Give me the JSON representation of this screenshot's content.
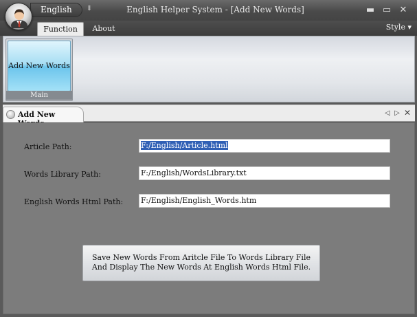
{
  "window": {
    "title": "English Helper System - [Add New Words]",
    "quick_access_label": "English",
    "controls": {
      "minimize": "▬",
      "maximize": "▭",
      "close": "✕"
    }
  },
  "ribbon": {
    "tabs": [
      {
        "label": "Function",
        "selected": true
      },
      {
        "label": "About",
        "selected": false
      }
    ],
    "style_menu": "Style",
    "groups": [
      {
        "label": "Main",
        "buttons": [
          {
            "label": "Add New Words"
          }
        ]
      }
    ]
  },
  "document": {
    "tab_label": "Add New Words",
    "fields": [
      {
        "label": "Article Path:",
        "value": "F:/English/Article.html",
        "selected": true
      },
      {
        "label": "Words Library Path:",
        "value": "F:/English/WordsLibrary.txt"
      },
      {
        "label": "English Words Html Path:",
        "value": "F:/English/English_Words.htm"
      }
    ],
    "action_button": {
      "line1": "Save New Words From Aritcle File To Words Library File",
      "line2": "And Display The New Words At English Words Html File."
    }
  },
  "icons": {
    "app": "user-avatar-icon",
    "qat_dropdown": "chevron-down-icon",
    "doc_tab": "document-tab-icon",
    "nav_prev": "triangle-left-icon",
    "nav_next": "triangle-right-icon",
    "nav_close": "close-icon"
  },
  "colors": {
    "chrome_dark": "#4a4a4a",
    "panel_bg": "#7c7c7c",
    "ribbon_button": "#a8def3",
    "selection": "#2f5fb5"
  }
}
